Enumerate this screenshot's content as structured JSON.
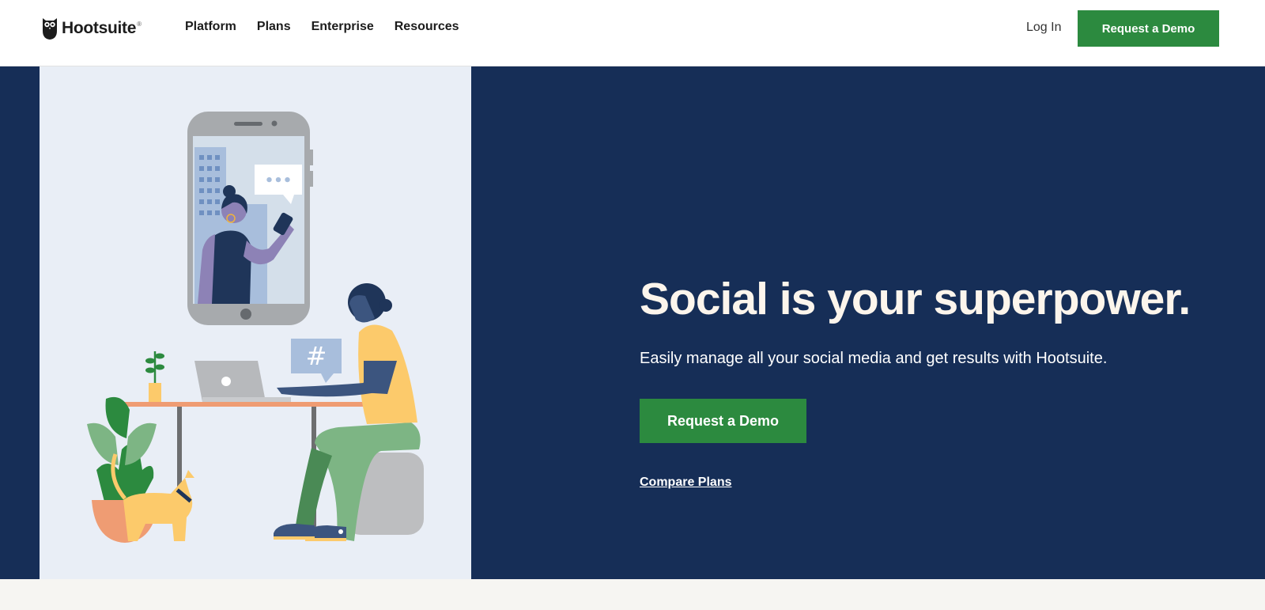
{
  "brand": {
    "name": "Hootsuite",
    "registered_mark": "®"
  },
  "nav": {
    "links": [
      "Platform",
      "Plans",
      "Enterprise",
      "Resources"
    ],
    "login_label": "Log In",
    "demo_label": "Request a Demo"
  },
  "hero": {
    "headline": "Social is your superpower.",
    "subhead": "Easily manage all your social media and get results with Hootsuite.",
    "cta_label": "Request a Demo",
    "compare_label": "Compare Plans",
    "chat_bubble_text": "•••",
    "hashtag_text": "#"
  },
  "colors": {
    "hero_background": "#162e57",
    "illustration_background": "#e9eef6",
    "cta_green": "#2c8a3f",
    "headline_cream": "#fcf5ec",
    "bottom_band": "#f6f5f2"
  },
  "icons": [
    "owl-logo-icon",
    "chat-bubble-icon",
    "hashtag-bubble-icon"
  ]
}
